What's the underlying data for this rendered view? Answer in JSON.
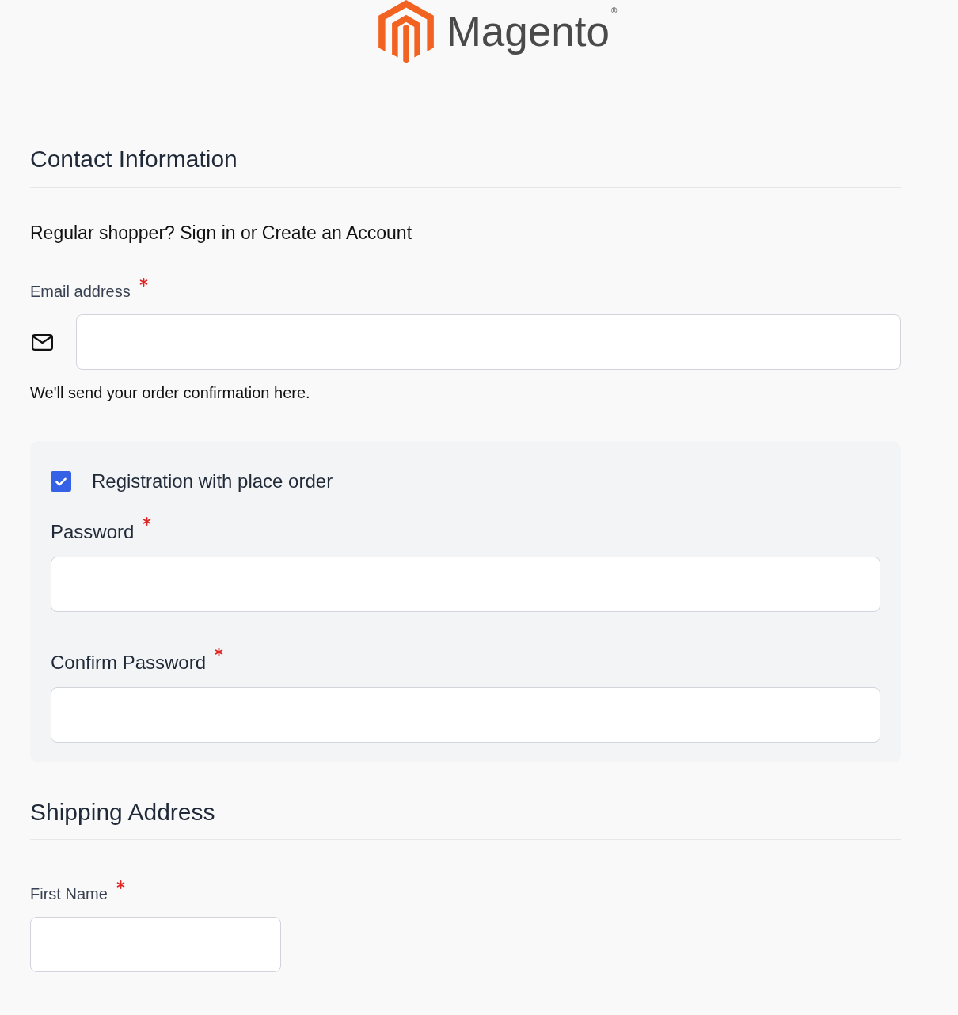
{
  "logo": {
    "name": "Magento$^{®}$"
  },
  "contact": {
    "title": "Contact Information",
    "prompt": "Regular shopper? Sign in or Create an Account",
    "email": {
      "label": "Email address",
      "required": true,
      "kind": "email"
    },
    "email_hint": "We'll send your order confirmation here.",
    "registration": {
      "label": "Registration with place order",
      "checked": true,
      "fields": [
        {
          "label": "Password",
          "required": true,
          "kind": "password"
        },
        {
          "label": "Confirm Password",
          "required": true,
          "kind": "password"
        }
      ]
    }
  },
  "shipping": {
    "title": "Shipping Address",
    "fields": [
      {
        "label": "First Name",
        "required": true,
        "kind": "text"
      }
    ]
  }
}
